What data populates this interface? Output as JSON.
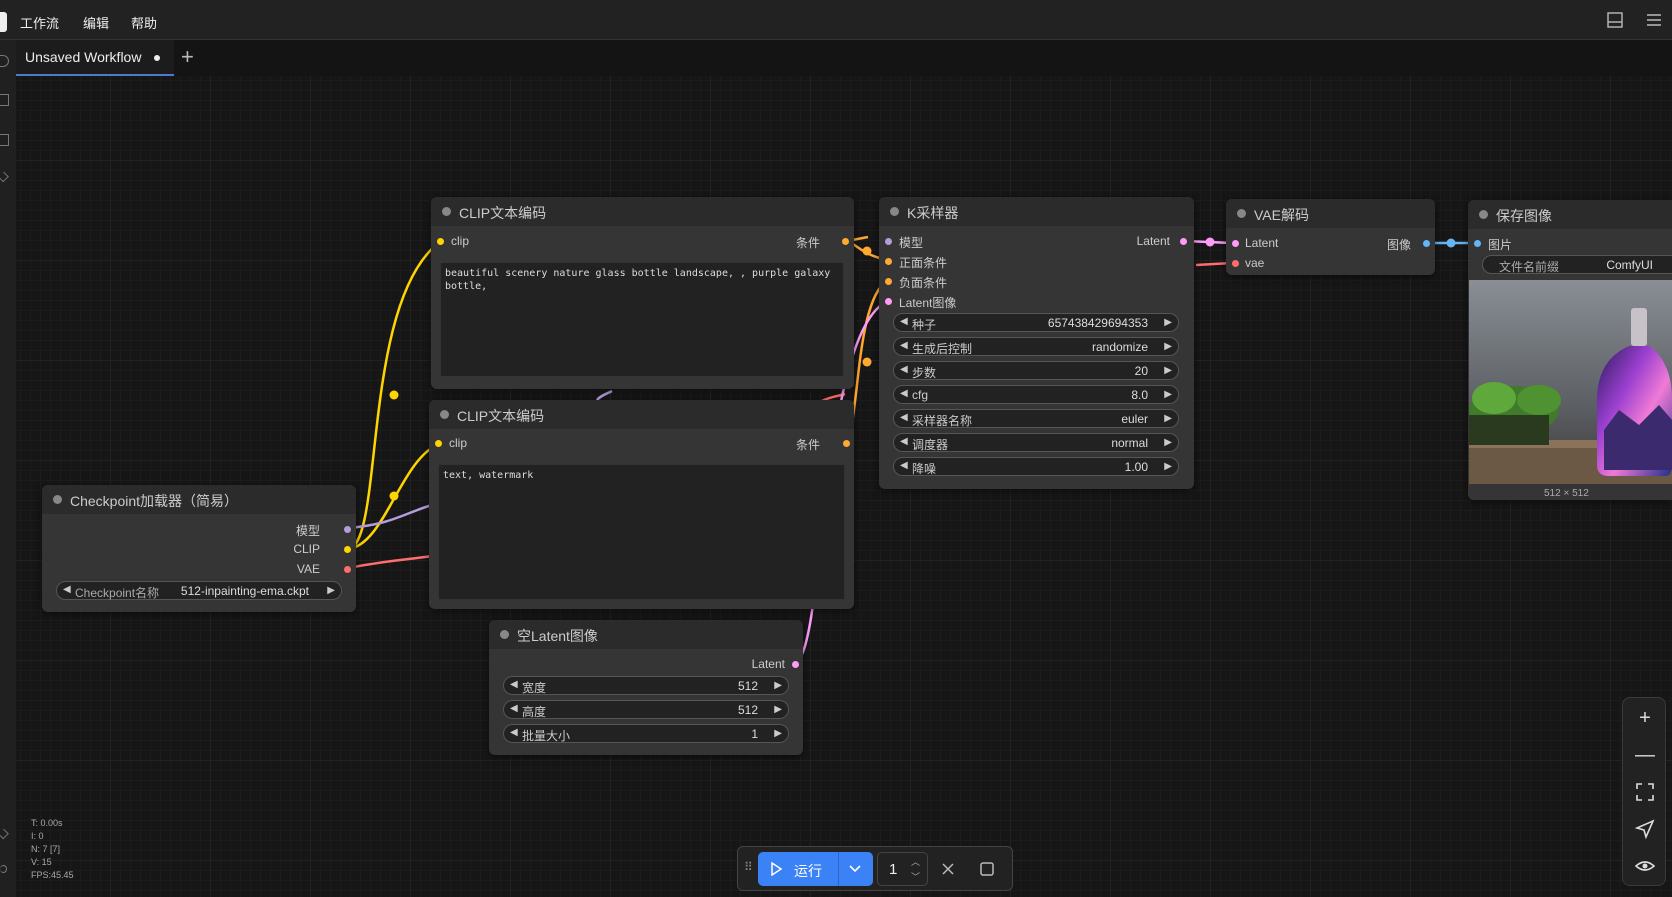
{
  "menu": {
    "workflow": "工作流",
    "edit": "编辑",
    "help": "帮助"
  },
  "tab": {
    "label": "Unsaved Workflow",
    "add_label": "+"
  },
  "colors": {
    "clip": "#ffd500",
    "model": "#b39ddb",
    "vae": "#ff6e6e",
    "latent": "#ff9cf9",
    "image": "#64b5f6",
    "cond": "#ffa931",
    "accent": "#3b82f6"
  },
  "nodes": {
    "clip_pos": {
      "title": "CLIP文本编码",
      "in_clip": "clip",
      "out": "条件",
      "text": "beautiful scenery nature glass bottle landscape, , purple galaxy bottle,"
    },
    "clip_neg": {
      "title": "CLIP文本编码",
      "in_clip": "clip",
      "out": "条件",
      "text": "text, watermark"
    },
    "checkpoint": {
      "title": "Checkpoint加载器（简易）",
      "out_model": "模型",
      "out_clip": "CLIP",
      "out_vae": "VAE",
      "w_label": "Checkpoint名称",
      "w_value": "512-inpainting-ema.ckpt"
    },
    "latent": {
      "title": "空Latent图像",
      "out": "Latent",
      "widgets": [
        {
          "label": "宽度",
          "value": "512"
        },
        {
          "label": "高度",
          "value": "512"
        },
        {
          "label": "批量大小",
          "value": "1"
        }
      ]
    },
    "ksampler": {
      "title": "K采样器",
      "in_model": "模型",
      "in_pos": "正面条件",
      "in_neg": "负面条件",
      "in_latent": "Latent图像",
      "out": "Latent",
      "widgets": [
        {
          "label": "种子",
          "value": "657438429694353"
        },
        {
          "label": "生成后控制",
          "value": "randomize"
        },
        {
          "label": "步数",
          "value": "20"
        },
        {
          "label": "cfg",
          "value": "8.0"
        },
        {
          "label": "采样器名称",
          "value": "euler"
        },
        {
          "label": "调度器",
          "value": "normal"
        },
        {
          "label": "降噪",
          "value": "1.00"
        }
      ]
    },
    "vae": {
      "title": "VAE解码",
      "in_latent": "Latent",
      "in_vae": "vae",
      "out": "图像"
    },
    "save": {
      "title": "保存图像",
      "in_image": "图片",
      "w_label": "文件名前缀",
      "w_value": "ComfyUI",
      "size": "512 × 512"
    }
  },
  "stats": {
    "t": "T: 0.00s",
    "i": "I: 0",
    "n": "N: 7 [7]",
    "v": "V: 15",
    "fps": "FPS:45.45"
  },
  "run": {
    "label": "运行",
    "count": "1"
  }
}
